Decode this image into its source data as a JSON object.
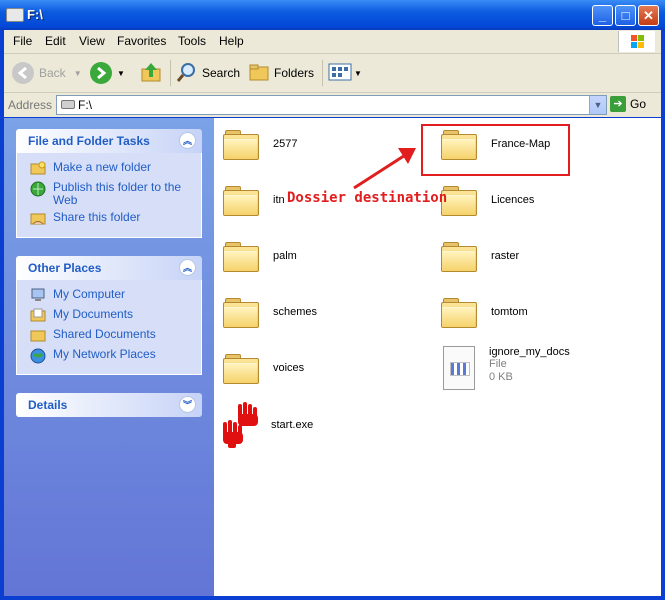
{
  "window": {
    "title": "F:\\"
  },
  "menu": [
    "File",
    "Edit",
    "View",
    "Favorites",
    "Tools",
    "Help"
  ],
  "toolbar": {
    "back_label": "Back",
    "search_label": "Search",
    "folders_label": "Folders"
  },
  "address": {
    "label": "Address",
    "value": "F:\\",
    "go_label": "Go"
  },
  "tasks_panel": {
    "title": "File and Folder Tasks",
    "items": [
      {
        "label": "Make a new folder",
        "icon": "new-folder-icon"
      },
      {
        "label": "Publish this folder to the Web",
        "icon": "publish-web-icon"
      },
      {
        "label": "Share this folder",
        "icon": "share-folder-icon"
      }
    ]
  },
  "places_panel": {
    "title": "Other Places",
    "items": [
      {
        "label": "My Computer",
        "icon": "my-computer-icon"
      },
      {
        "label": "My Documents",
        "icon": "my-documents-icon"
      },
      {
        "label": "Shared Documents",
        "icon": "shared-documents-icon"
      },
      {
        "label": "My Network Places",
        "icon": "network-places-icon"
      }
    ]
  },
  "details_panel": {
    "title": "Details"
  },
  "files": {
    "f2577": "2577",
    "itn": "itn",
    "palm": "palm",
    "schemes": "schemes",
    "voices": "voices",
    "start": "start.exe",
    "france": "France-Map",
    "licences": "Licences",
    "raster": "raster",
    "tomtom": "tomtom",
    "ignore": {
      "name": "ignore_my_docs",
      "type": "File",
      "size": "0 KB"
    }
  },
  "annotation": {
    "text": "Dossier destination",
    "color": "#e21d1d"
  },
  "colors": {
    "titlebar": "#0b5be0",
    "taskpane": "#6375d6",
    "link": "#215dc6"
  }
}
